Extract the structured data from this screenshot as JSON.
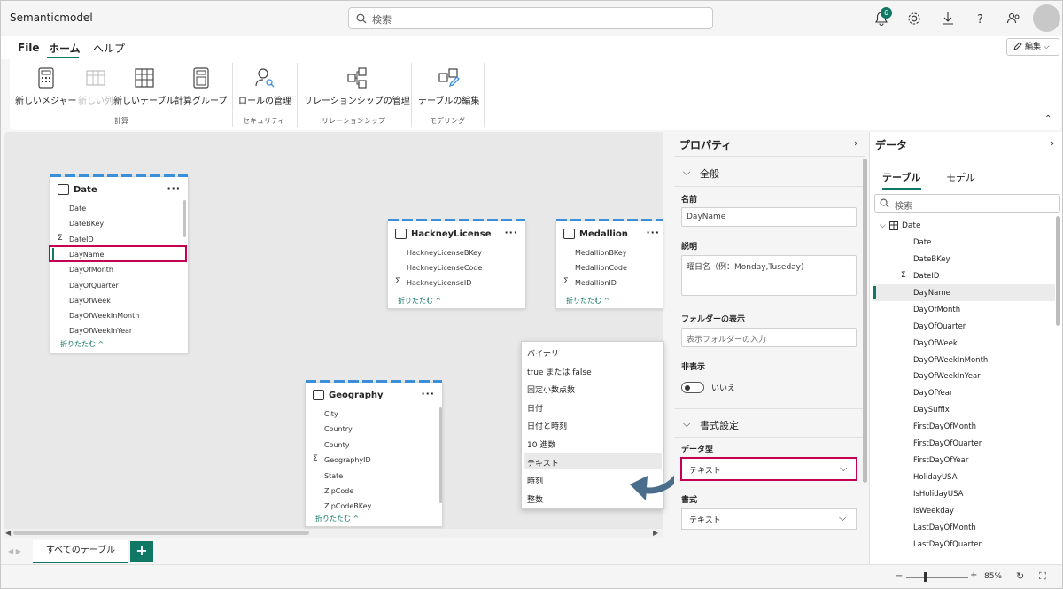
{
  "header": {
    "model_name": "Semanticmodel",
    "search_placeholder": "検索",
    "notif_count": "6"
  },
  "ribbon": {
    "tabs": [
      "File",
      "ホーム",
      "ヘルプ"
    ],
    "edit_label": "編集",
    "buttons": [
      "新しいメジャー",
      "新しい列",
      "新しいテーブル",
      "計算グループ",
      "ロールの管理",
      "リレーションシップの管理",
      "テーブルの編集"
    ],
    "groups": [
      "計算",
      "セキュリティ",
      "リレーションシップ",
      "モデリング"
    ]
  },
  "canvas": {
    "tables": [
      {
        "name": "Date",
        "fields": [
          "Date",
          "DateBKey",
          "DateID",
          "DayName",
          "DayOfMonth",
          "DayOfQuarter",
          "DayOfWeek",
          "DayOfWeekInMonth",
          "DayOfWeekInYear"
        ],
        "sigma": "DateID",
        "collapse": "折りたたむ ^"
      },
      {
        "name": "HackneyLicense",
        "fields": [
          "HackneyLicenseBKey",
          "HackneyLicenseCode",
          "HackneyLicenseID"
        ],
        "sigma": "HackneyLicenseID",
        "collapse": "折りたたむ ^"
      },
      {
        "name": "Medallion",
        "fields": [
          "MedallionBKey",
          "MedallionCode",
          "MedallionID"
        ],
        "sigma": "MedallionID",
        "collapse": "折りたたむ ^"
      },
      {
        "name": "Geography",
        "fields": [
          "City",
          "Country",
          "County",
          "GeographyID",
          "State",
          "ZipCode",
          "ZipCodeBKey"
        ],
        "sigma": "GeographyID",
        "collapse": "折りたたむ ^"
      }
    ],
    "datatype_options": [
      "バイナリ",
      "true または false",
      "固定小数点数",
      "日付",
      "日付と時刻",
      "10 進数",
      "テキスト",
      "時刻",
      "整数"
    ],
    "datatype_selected": "テキスト"
  },
  "bottom": {
    "tab_label": "すべてのテーブル",
    "add": "+",
    "zoom": "85%"
  },
  "properties": {
    "title": "プロパティ",
    "section_general": "全般",
    "name_label": "名前",
    "name_value": "DayName",
    "desc_label": "説明",
    "desc_value": "曜日名（例：Monday,Tuseday)",
    "folder_label": "フォルダーの表示",
    "folder_placeholder": "表示フォルダーの入力",
    "hidden_label": "非表示",
    "hidden_value": "いいえ",
    "section_format": "書式設定",
    "datatype_label": "データ型",
    "datatype_value": "テキスト",
    "format_label": "書式",
    "format_value": "テキスト"
  },
  "data": {
    "title": "データ",
    "tabs": [
      "テーブル",
      "モデル"
    ],
    "search_placeholder": "検索",
    "table_name": "Date",
    "items": [
      "Date",
      "DateBKey",
      "DateID",
      "DayName",
      "DayOfMonth",
      "DayOfQuarter",
      "DayOfWeek",
      "DayOfWeekInMonth",
      "DayOfWeekInYear",
      "DayOfYear",
      "DaySuffix",
      "FirstDayOfMonth",
      "FirstDayOfQuarter",
      "FirstDayOfYear",
      "HolidayUSA",
      "IsHolidayUSA",
      "IsWeekday",
      "LastDayOfMonth",
      "LastDayOfQuarter"
    ],
    "selected": "DayName"
  },
  "colors": {
    "accent": "#117865",
    "highlight": "#c30052",
    "arrow": "#4a6d8c"
  }
}
